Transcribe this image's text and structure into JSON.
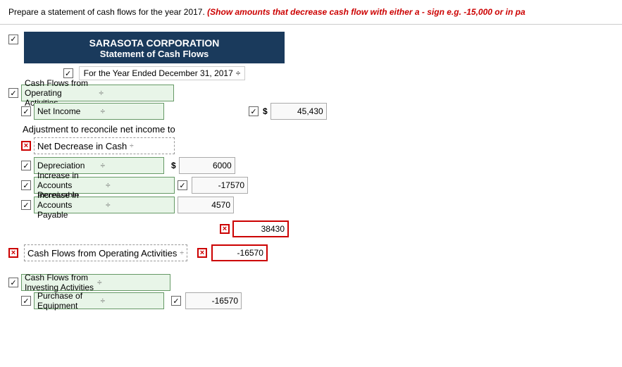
{
  "instruction": {
    "text": "Prepare a statement of cash flows for the year 2017.",
    "highlight": "(Show amounts that decrease cash flow with either a - sign e.g. -15,000 or in pa"
  },
  "header": {
    "corp_name": "SARASOTA CORPORATION",
    "stmt_title": "Statement of Cash Flows",
    "year_label": "For the Year Ended December 31, 2017"
  },
  "sections": {
    "operating": {
      "label": "Cash Flows from Operating Activities",
      "net_income_label": "Net Income",
      "net_income_value": "45,430",
      "adjustment_label": "Adjustment to reconcile net income to",
      "net_decrease_label": "Net Decrease in Cash",
      "depreciation_label": "Depreciation",
      "depreciation_value": "6000",
      "accounts_receivable_label": "Increase in Accounts Receivable",
      "accounts_receivable_value": "-17570",
      "accounts_payable_label": "Increase in Accounts Payable",
      "accounts_payable_value": "4570",
      "subtotal_value": "38430",
      "total_label": "Cash Flows from Operating Activities",
      "total_value": "-16570"
    },
    "investing": {
      "label": "Cash Flows from Investing Activities",
      "purchase_equipment_label": "Purchase of Equipment",
      "purchase_equipment_value": "-16570"
    }
  },
  "icons": {
    "dropdown_arrow": "÷",
    "checkmark": "✓",
    "x_mark": "×"
  }
}
